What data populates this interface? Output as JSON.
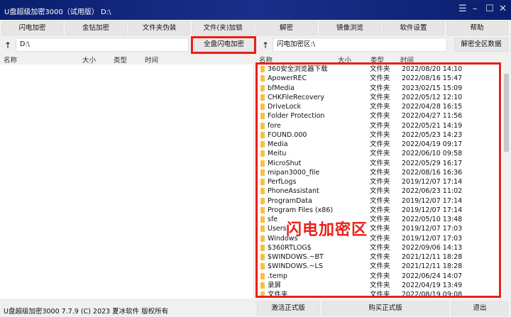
{
  "window": {
    "title": "U盘超级加密3000（试用版） D:\\"
  },
  "toolbar": [
    "闪电加密",
    "金钻加密",
    "文件夹伪装",
    "文件(夹)加锁",
    "解密",
    "镜像浏览",
    "软件设置",
    "帮助"
  ],
  "left": {
    "path": "D:\\",
    "encrypt_all": "全盘闪电加密",
    "columns": [
      "名称",
      "大小",
      "类型",
      "时间"
    ]
  },
  "right": {
    "path": "闪电加密区:\\",
    "decrypt_all": "解密全区数据",
    "columns": [
      "名称",
      "大小",
      "类型",
      "时间"
    ],
    "overlay": "闪电加密区",
    "rows": [
      [
        "360安全浏览器下载",
        "文件夹",
        "2022/08/20 14:10"
      ],
      [
        "ApowerREC",
        "文件夹",
        "2022/08/16 15:47"
      ],
      [
        "bfMedia",
        "文件夹",
        "2023/02/15 15:09"
      ],
      [
        "CHKFileRecovery",
        "文件夹",
        "2022/05/12 12:10"
      ],
      [
        "DriveLock",
        "文件夹",
        "2022/04/28 16:15"
      ],
      [
        "Folder Protection",
        "文件夹",
        "2022/04/27 11:56"
      ],
      [
        "fore",
        "文件夹",
        "2022/05/21 14:19"
      ],
      [
        "FOUND.000",
        "文件夹",
        "2022/05/23 14:23"
      ],
      [
        "Media",
        "文件夹",
        "2022/04/19 09:17"
      ],
      [
        "Meitu",
        "文件夹",
        "2022/06/10 09:58"
      ],
      [
        "MicroShut",
        "文件夹",
        "2022/05/29 16:17"
      ],
      [
        "mipan3000_file",
        "文件夹",
        "2022/08/16 16:36"
      ],
      [
        "PerfLogs",
        "文件夹",
        "2019/12/07 17:14"
      ],
      [
        "PhoneAssistant",
        "文件夹",
        "2022/06/23 11:02"
      ],
      [
        "ProgramData",
        "文件夹",
        "2019/12/07 17:14"
      ],
      [
        "Program Files (x86)",
        "文件夹",
        "2019/12/07 17:14"
      ],
      [
        "sfe",
        "文件夹",
        "2022/05/10 13:48"
      ],
      [
        "Users",
        "文件夹",
        "2019/12/07 17:03"
      ],
      [
        "Windows",
        "文件夹",
        "2019/12/07 17:03"
      ],
      [
        "$360RTLOG$",
        "文件夹",
        "2022/09/06 14:13"
      ],
      [
        "$WINDOWS.~BT",
        "文件夹",
        "2021/12/11 18:28"
      ],
      [
        "$WINDOWS.~LS",
        "文件夹",
        "2021/12/11 18:28"
      ],
      [
        ".temp",
        "文件夹",
        "2022/06/24 14:07"
      ],
      [
        "录屏",
        "文件夹",
        "2022/04/19 13:49"
      ],
      [
        "文件夹",
        "文件夹",
        "2022/08/19 09:08"
      ]
    ]
  },
  "status": {
    "text": "U盘超级加密3000 7.7.9 (C) 2023 夏冰软件 版权所有",
    "activate": "激活正式版",
    "buy": "购买正式版",
    "exit": "退出"
  }
}
